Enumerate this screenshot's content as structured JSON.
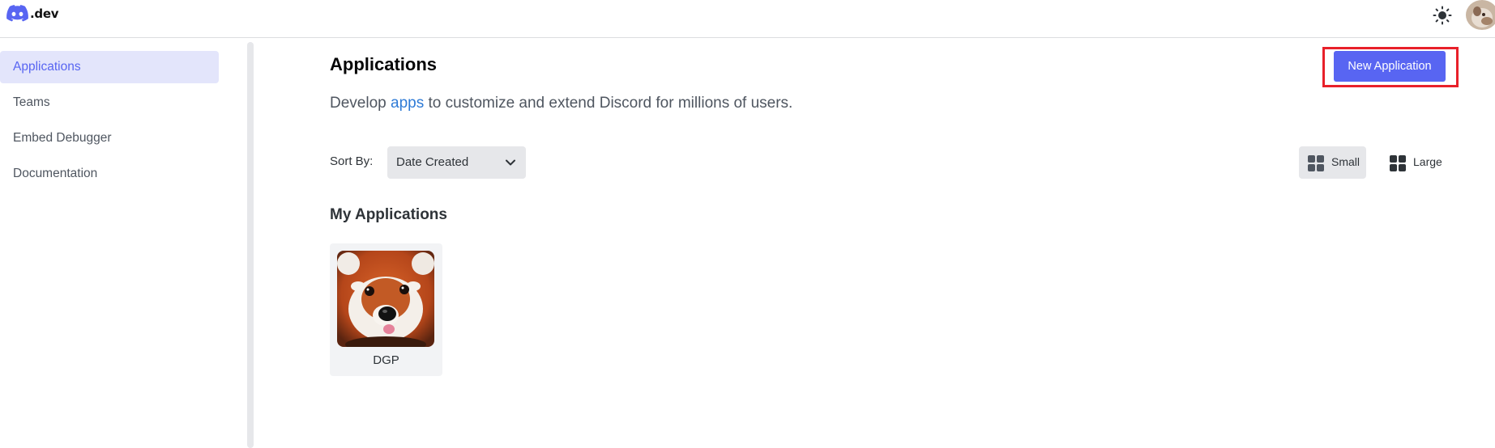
{
  "topbar": {
    "logo_text": ".dev",
    "logo_icon": "discord-icon",
    "theme_icon": "sun-icon",
    "avatar_icon": "user-avatar"
  },
  "sidebar": {
    "items": [
      {
        "label": "Applications",
        "active": true
      },
      {
        "label": "Teams",
        "active": false
      },
      {
        "label": "Embed Debugger",
        "active": false
      },
      {
        "label": "Documentation",
        "active": false
      }
    ]
  },
  "main": {
    "title": "Applications",
    "desc_before": "Develop ",
    "desc_link": "apps",
    "desc_after": " to customize and extend Discord for millions of users.",
    "new_app_label": "New Application",
    "sort_label": "Sort By:",
    "sort_value": "Date Created",
    "view_small_label": "Small",
    "view_large_label": "Large",
    "section_title": "My Applications",
    "apps": [
      {
        "name": "DGP",
        "icon": "red-panda-image"
      }
    ]
  },
  "colors": {
    "accent": "#5865f2",
    "highlight": "#e8202a",
    "link": "#2f7bd6"
  }
}
